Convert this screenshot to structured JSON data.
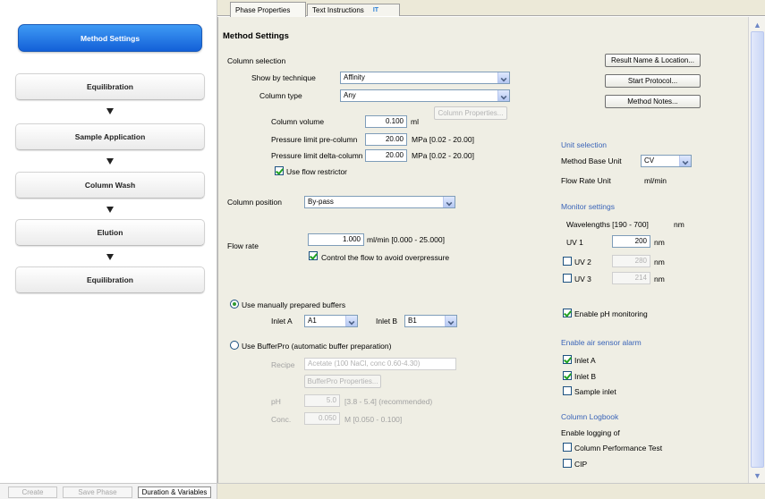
{
  "flow": {
    "active_step": "Method Settings",
    "steps": [
      "Equilibration",
      "Sample Application",
      "Column Wash",
      "Elution",
      "Equilibration"
    ]
  },
  "bottom_buttons": {
    "create": "Create",
    "save_phase": "Save Phase",
    "duration": "Duration & Variables"
  },
  "tabs": {
    "phase_properties": "Phase Properties",
    "text_instructions": "Text Instructions",
    "extra_tab_icon": "IT"
  },
  "method": {
    "title": "Method Settings",
    "column_selection": {
      "heading": "Column selection",
      "technique_label": "Show by technique",
      "technique_value": "Affinity",
      "type_label": "Column type",
      "type_value": "Any",
      "volume_label": "Column volume",
      "volume_value": "0.100",
      "volume_unit": "ml",
      "properties_button": "Column Properties...",
      "pressure_pre_label": "Pressure limit pre-column",
      "pressure_pre_value": "20.00",
      "pressure_pre_range": "MPa [0.02 - 20.00]",
      "pressure_delta_label": "Pressure limit delta-column",
      "pressure_delta_value": "20.00",
      "pressure_delta_range": "MPa [0.02 - 20.00]",
      "flow_restrictor_label": "Use flow restrictor",
      "flow_restrictor_checked": true
    },
    "column_position": {
      "label": "Column position",
      "value": "By-pass"
    },
    "flow": {
      "label": "Flow rate",
      "value": "1.000",
      "unit_range": "ml/min  [0.000 - 25.000]",
      "control_label": "Control the flow to avoid overpressure",
      "control_checked": true
    },
    "buffers": {
      "manual_label": "Use manually prepared buffers",
      "manual_selected": true,
      "inlet_a_label": "Inlet A",
      "inlet_a_value": "A1",
      "inlet_b_label": "Inlet B",
      "inlet_b_value": "B1",
      "bufferpro_label": "Use BufferPro (automatic buffer preparation)",
      "recipe_label": "Recipe",
      "recipe_value": "Acetate (100 NaCl, conc 0.60-4.30)",
      "bufferpro_button": "BufferPro Properties...",
      "ph_label": "pH",
      "ph_value": "5.0",
      "ph_range": "[3.8 - 5.4]   (recommended)",
      "conc_label": "Conc.",
      "conc_value": "0.050",
      "conc_range": "M  [0.050 - 0.100]"
    },
    "buttons": {
      "result_name": "Result Name & Location...",
      "start_protocol": "Start Protocol...",
      "method_notes": "Method Notes..."
    },
    "unit_selection": {
      "heading": "Unit selection",
      "base_label": "Method Base Unit",
      "base_value": "CV",
      "flow_label": "Flow Rate Unit",
      "flow_value": "ml/min"
    },
    "monitor": {
      "heading": "Monitor settings",
      "wavelengths_label": "Wavelengths  [190 - 700]",
      "wavelengths_unit": "nm",
      "uv1_label": "UV 1",
      "uv1_value": "200",
      "uv1_unit": "nm",
      "uv2_label": "UV 2",
      "uv2_value": "280",
      "uv2_unit": "nm",
      "uv2_checked": false,
      "uv3_label": "UV 3",
      "uv3_value": "214",
      "uv3_unit": "nm",
      "uv3_checked": false,
      "ph_label": "Enable pH monitoring",
      "ph_checked": true
    },
    "air_sensor": {
      "heading": "Enable air sensor alarm",
      "inlet_a": "Inlet A",
      "inlet_a_checked": true,
      "inlet_b": "Inlet B",
      "inlet_b_checked": true,
      "sample_inlet": "Sample inlet",
      "sample_inlet_checked": false
    },
    "logbook": {
      "heading": "Column Logbook",
      "enable_label": "Enable logging of",
      "performance_label": "Column Performance Test",
      "performance_checked": false,
      "cip_label": "CIP",
      "cip_checked": false
    }
  },
  "colors": {
    "active_step_top": "#3f9af4",
    "active_step_bottom": "#1360d8",
    "panel_bg": "#efeee4",
    "heading_blue": "#3a64b8",
    "check_green": "#21a121"
  }
}
